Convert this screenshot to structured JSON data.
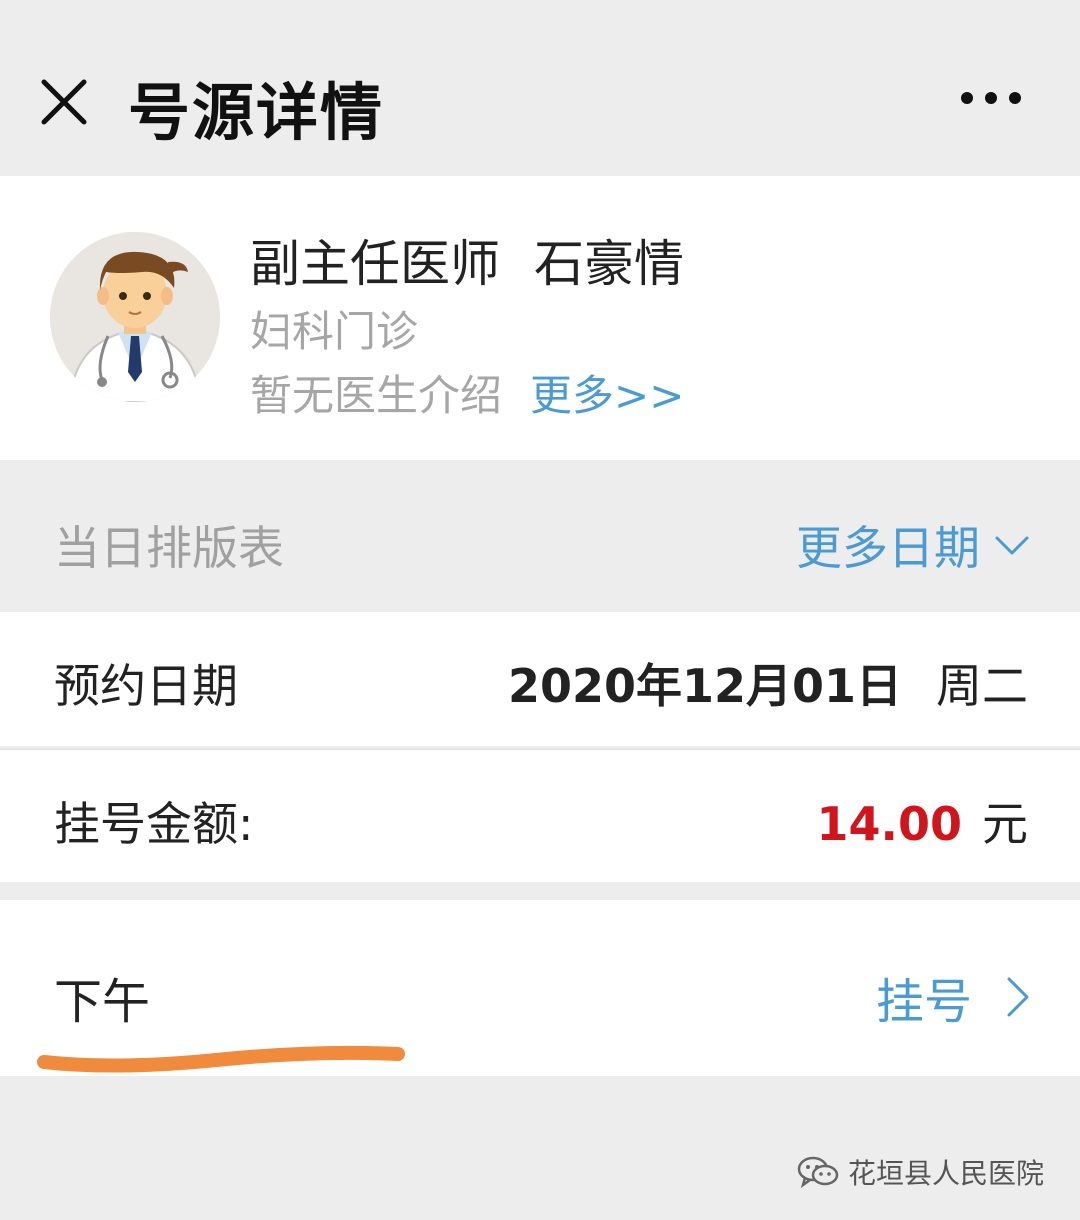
{
  "header": {
    "title": "号源详情",
    "close_icon": "close-icon",
    "more_icon": "more-dots-icon"
  },
  "doctor": {
    "title": "副主任医师",
    "name": "石豪情",
    "department": "妇科门诊",
    "intro": "暂无医生介绍",
    "more_link": "更多>>"
  },
  "schedule": {
    "label": "当日排版表",
    "more_dates": "更多日期"
  },
  "appointment": {
    "date_label": "预约日期",
    "date_value": "2020年12月01日",
    "weekday": "周二",
    "fee_label": "挂号金额:",
    "fee_amount": "14.00",
    "fee_unit": "元"
  },
  "session": {
    "label": "下午",
    "register": "挂号"
  },
  "watermark": {
    "text": "花垣县人民医院"
  },
  "colors": {
    "link_blue": "#4a9bd3",
    "price_red": "#d0151c",
    "highlight_orange": "#f08a3c",
    "page_bg": "#ededed"
  }
}
